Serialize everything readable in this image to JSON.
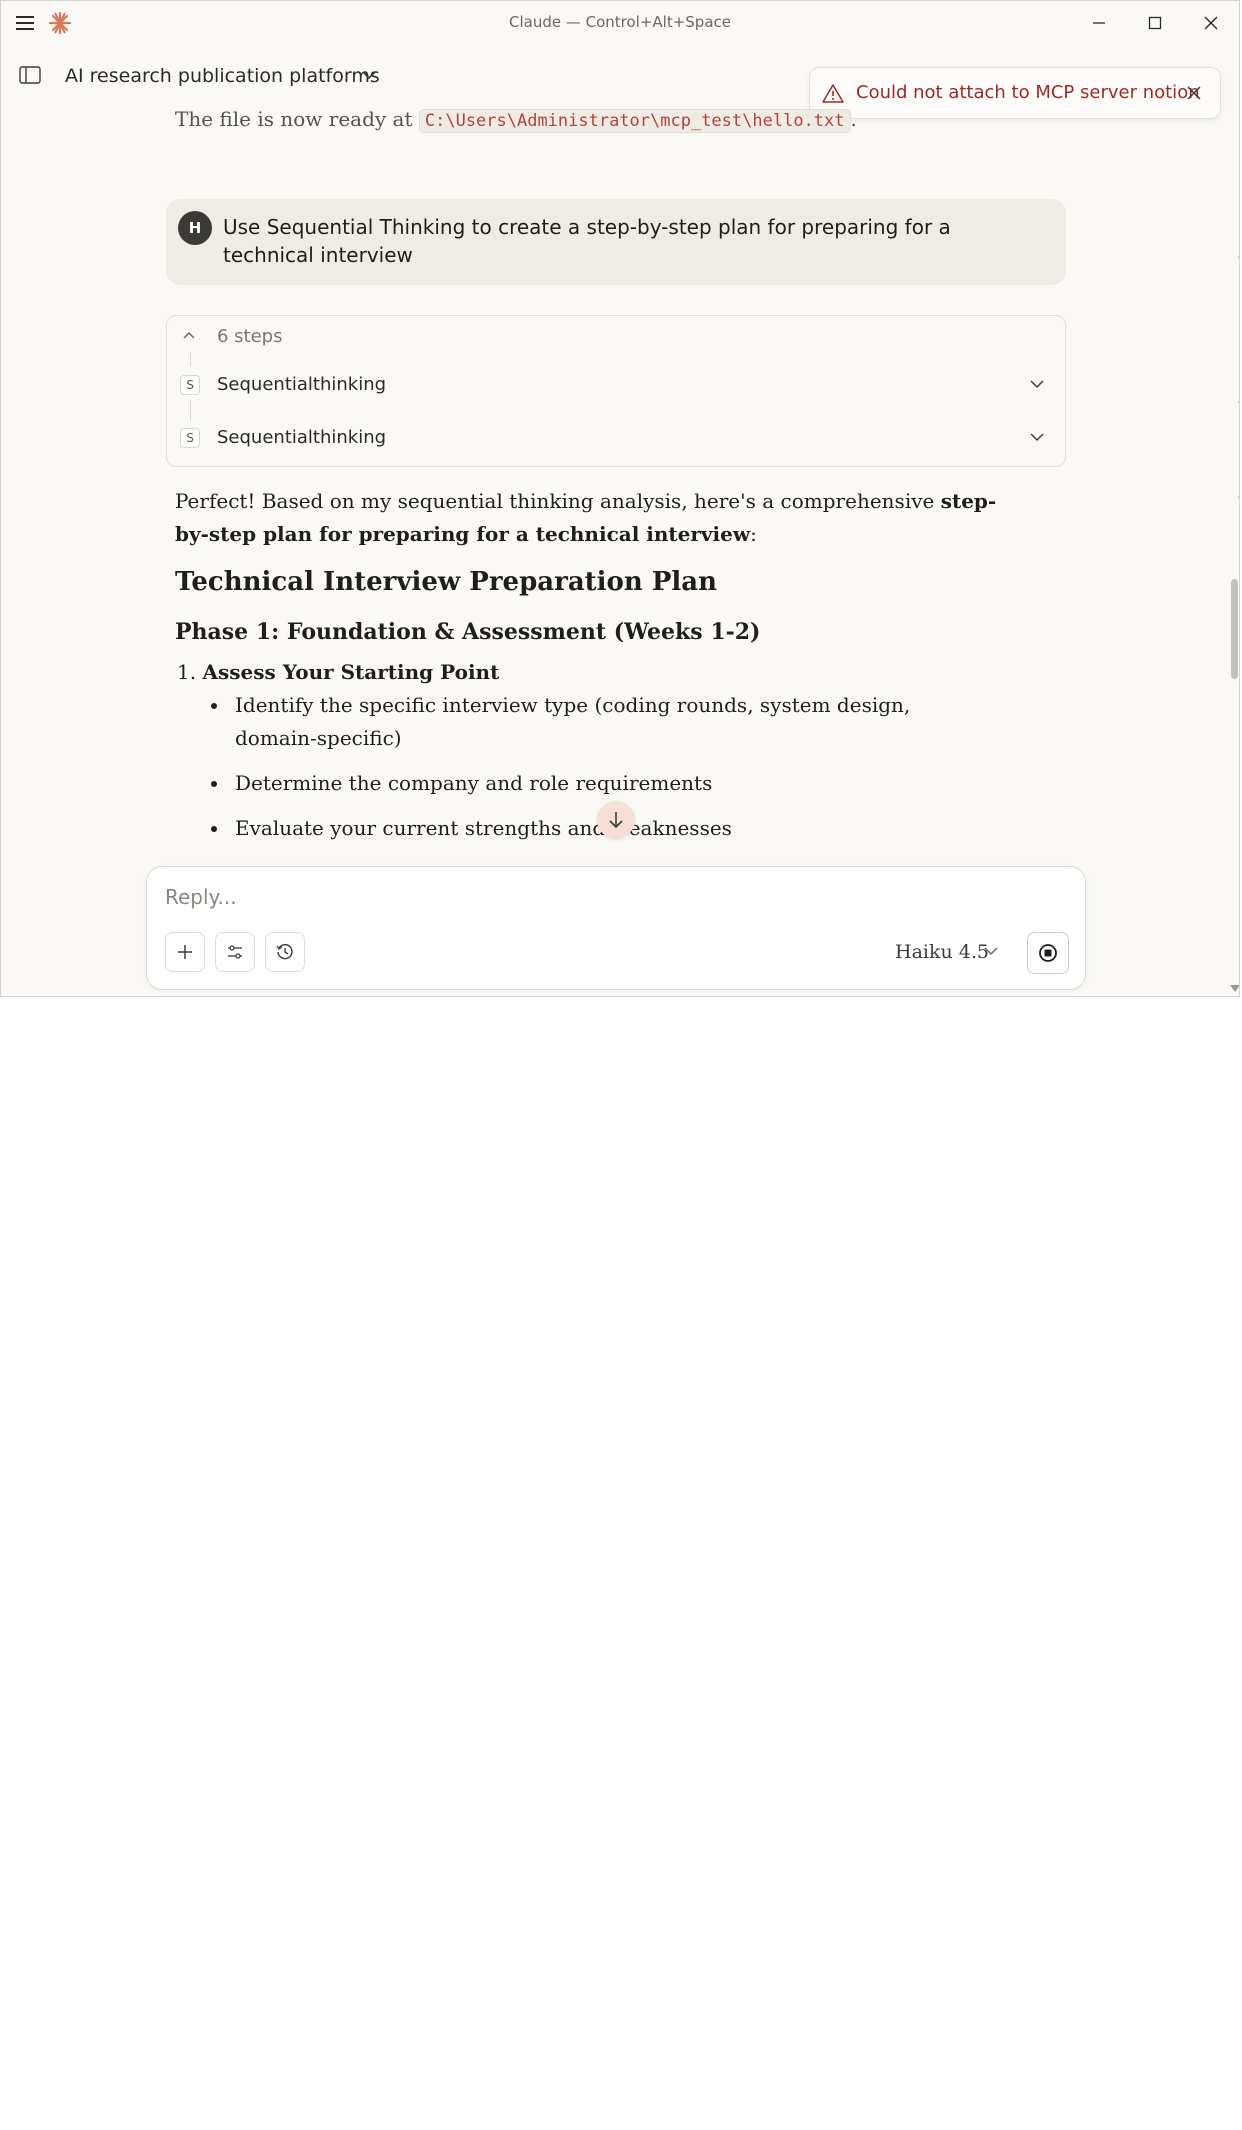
{
  "window": {
    "title": "Claude — Control+Alt+Space"
  },
  "toolbar": {
    "chat_title": "AI research publication platforms"
  },
  "toast": {
    "message": "Could not attach to MCP server notion"
  },
  "conversation": {
    "previous": {
      "text_before": "The file is now ready at ",
      "path": "C:\\Users\\Administrator\\mcp_test\\hello.txt",
      "text_after": "."
    },
    "user_message": {
      "avatar_initial": "H",
      "text": "Use Sequential Thinking to create a step-by-step plan for preparing for a technical interview"
    },
    "steps": {
      "count_label": "6 steps",
      "items": [
        {
          "icon": "S",
          "label": "Sequentialthinking"
        },
        {
          "icon": "S",
          "label": "Sequentialthinking"
        }
      ]
    },
    "answer": {
      "intro_plain": "Perfect! Based on my sequential thinking analysis, here's a comprehensive ",
      "intro_bold": "step-by-step plan for preparing for a technical interview",
      "intro_end": ":",
      "heading": "Technical Interview Preparation Plan",
      "phase_heading": "Phase 1: Foundation & Assessment (Weeks 1-2)",
      "list_number": "1.",
      "list_item_title": "Assess Your Starting Point",
      "bullets": [
        "Identify the specific interview type (coding rounds, system design, domain-specific)",
        "Determine the company and role requirements",
        "Evaluate your current strengths and weaknesses"
      ]
    }
  },
  "composer": {
    "placeholder": "Reply...",
    "model_label": "Haiku 4.5"
  },
  "colors": {
    "background": "#faf9f5",
    "accent": "#d97757",
    "error_text": "#9b2a23"
  }
}
